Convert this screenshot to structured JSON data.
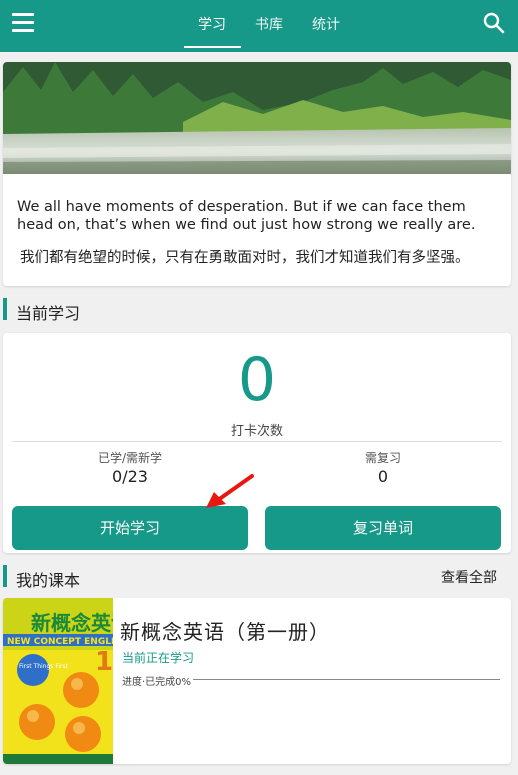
{
  "header": {
    "tabs": [
      {
        "label": "学习",
        "active": true
      },
      {
        "label": "书库",
        "active": false
      },
      {
        "label": "统计",
        "active": false
      }
    ],
    "accent_color": "#17998a"
  },
  "quote": {
    "english": "We all have moments of desperation. But if we can face them head on, that’s when we find out just how strong we really are.",
    "chinese": "我们都有绝望的时候，只有在勇敢面对时，我们才知道我们有多坚强。"
  },
  "current_study": {
    "section_title": "当前学习",
    "checkin_count": "0",
    "checkin_label": "打卡次数",
    "learned_label": "已学/需新学",
    "learned_value": "0/23",
    "review_label": "需复习",
    "review_value": "0",
    "start_button": "开始学习",
    "review_button": "复习单词"
  },
  "textbooks": {
    "section_title": "我的课本",
    "view_all": "查看全部",
    "book": {
      "title": "新概念英语（第一册）",
      "status": "当前正在学习",
      "progress_label": "进度·已完成0%",
      "progress": 0,
      "cover_title": "新概念英语",
      "cover_subtitle": "NEW CONCEPT ENGLISH",
      "cover_volume": "1",
      "cover_badge": "First Things First"
    }
  }
}
